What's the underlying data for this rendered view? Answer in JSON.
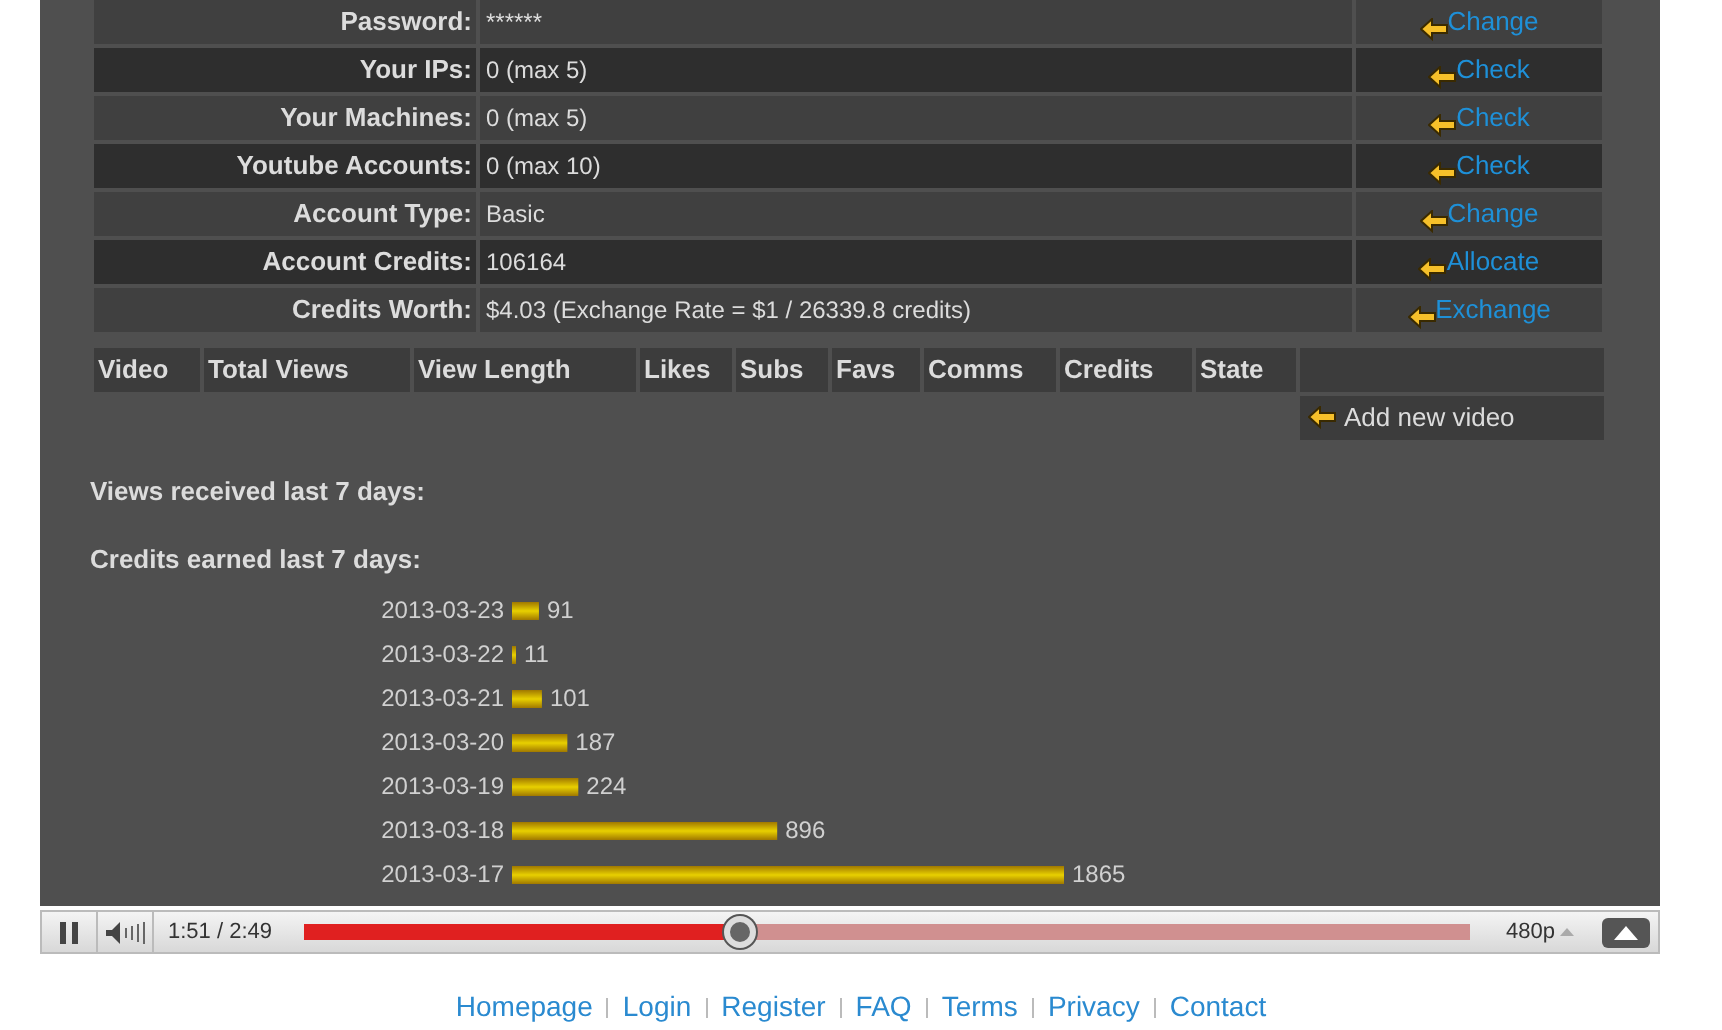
{
  "account": [
    {
      "label": "Password:",
      "value": "******",
      "action": "Change"
    },
    {
      "label": "Your IPs:",
      "value": "0 (max 5)",
      "action": "Check"
    },
    {
      "label": "Your Machines:",
      "value": "0 (max 5)",
      "action": "Check"
    },
    {
      "label": "Youtube Accounts:",
      "value": "0 (max 10)",
      "action": "Check"
    },
    {
      "label": "Account Type:",
      "value": "Basic",
      "action": "Change"
    },
    {
      "label": "Account Credits:",
      "value": "106164",
      "action": "Allocate"
    },
    {
      "label": "Credits Worth:",
      "value": "$4.03 (Exchange Rate = $1 / 26339.8 credits)",
      "action": "Exchange"
    }
  ],
  "videos": {
    "columns": [
      "Video",
      "Total Views",
      "View Length",
      "Likes",
      "Subs",
      "Favs",
      "Comms",
      "Credits",
      "State"
    ],
    "add_button": "Add new video"
  },
  "views_heading": "Views received last 7 days:",
  "credits_heading": "Credits earned last 7 days:",
  "chart_data": {
    "type": "bar",
    "orientation": "horizontal",
    "data_labels": true,
    "categories": [
      "2013-03-23",
      "2013-03-22",
      "2013-03-21",
      "2013-03-20",
      "2013-03-19",
      "2013-03-18",
      "2013-03-17"
    ],
    "series": [
      {
        "color": "#e8d000",
        "values": [
          91,
          11,
          101,
          187,
          224,
          896,
          1865
        ]
      }
    ]
  },
  "player": {
    "time": "1:51 / 2:49",
    "level": 0.374,
    "quality": "480p"
  },
  "footer": [
    "Homepage",
    "Login",
    "Register",
    "FAQ",
    "Terms",
    "Privacy",
    "Contact"
  ]
}
